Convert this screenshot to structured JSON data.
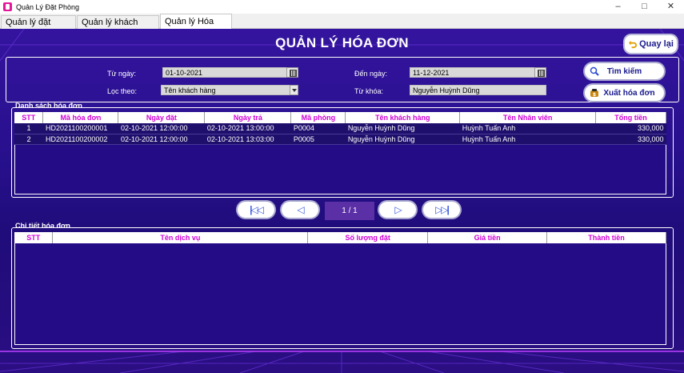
{
  "window": {
    "title": "Quản Lý Đặt Phòng"
  },
  "tabs": [
    {
      "label": "Quản lý đặt phòng"
    },
    {
      "label": "Quản lý khách hàng"
    },
    {
      "label": "Quản lý Hóa đơn"
    }
  ],
  "header": {
    "title": "QUẢN LÝ HÓA ĐƠN",
    "back_label": "Quay lại"
  },
  "filters": {
    "from_label": "Từ ngày:",
    "from_value": "01-10-2021",
    "to_label": "Đến ngày:",
    "to_value": "11-12-2021",
    "filter_label": "Lọc theo:",
    "filter_value": "Tên khách hàng",
    "keyword_label": "Từ khóa:",
    "keyword_value": "Nguyễn Huỳnh Dũng"
  },
  "actions": {
    "search_label": "Tìm kiếm",
    "export_label": "Xuất hóa đơn"
  },
  "invoices": {
    "section_title": "Danh sách hóa đơn",
    "columns": [
      "STT",
      "Mã hóa đơn",
      "Ngày đặt",
      "Ngày trả",
      "Mã phòng",
      "Tên khách hàng",
      "Tên Nhân viên",
      "Tổng tiền"
    ],
    "rows": [
      [
        "1",
        "HD2021100200001",
        "02-10-2021 12:00:00",
        "02-10-2021 13:00:00",
        "P0004",
        "Nguyễn Huỳnh Dũng",
        "Huỳnh Tuấn Anh",
        "330,000"
      ],
      [
        "2",
        "HD2021100200002",
        "02-10-2021 12:00:00",
        "02-10-2021 13:03:00",
        "P0005",
        "Nguyễn Huỳnh Dũng",
        "Huỳnh Tuấn Anh",
        "330,000"
      ]
    ]
  },
  "pagination": {
    "indicator": "1 / 1"
  },
  "details": {
    "section_title": "Chi tiết hóa đơn",
    "columns": [
      "STT",
      "Tên dịch vụ",
      "Số lượng đặt",
      "Giá tiền",
      "Thành tiền"
    ]
  },
  "colors": {
    "background": "#28108e",
    "header_text": "#d100d6",
    "button_text": "#1a1a8e",
    "nav_icon": "#3a5be0"
  }
}
